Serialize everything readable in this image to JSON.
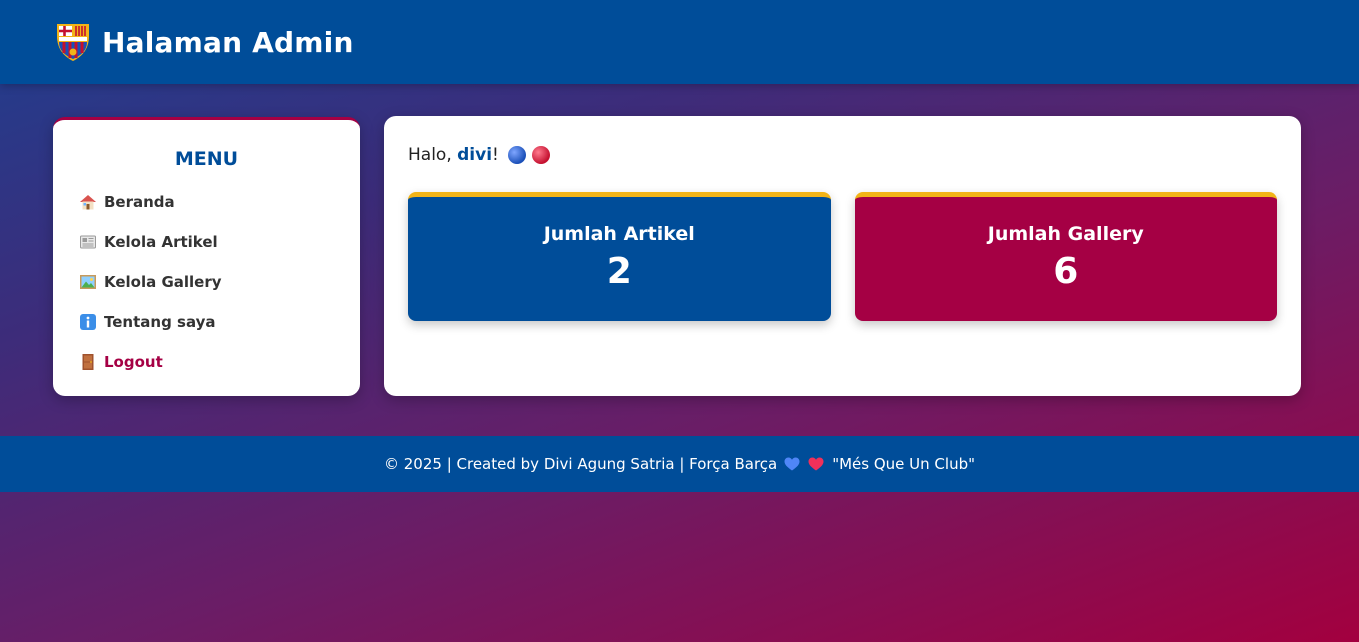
{
  "header": {
    "title": "Halaman Admin",
    "logo_icon": "fcb-crest-icon"
  },
  "sidebar": {
    "title": "MENU",
    "items": [
      {
        "label": "Beranda",
        "icon": "house-icon"
      },
      {
        "label": "Kelola Artikel",
        "icon": "newspaper-icon"
      },
      {
        "label": "Kelola Gallery",
        "icon": "picture-icon"
      },
      {
        "label": "Tentang saya",
        "icon": "info-icon"
      },
      {
        "label": "Logout",
        "icon": "door-icon"
      }
    ]
  },
  "main": {
    "greeting_prefix": "Halo, ",
    "username": "divi",
    "greeting_suffix": "!",
    "cards": [
      {
        "title": "Jumlah Artikel",
        "value": "2"
      },
      {
        "title": "Jumlah Gallery",
        "value": "6"
      }
    ]
  },
  "footer": {
    "text_before": "© 2025 | Created by Divi Agung Satria | Força Barça",
    "text_after": "\"Més Que Un Club\""
  },
  "colors": {
    "primary_blue": "#004d99",
    "primary_red": "#a50044",
    "accent_gold": "#f2b418"
  }
}
